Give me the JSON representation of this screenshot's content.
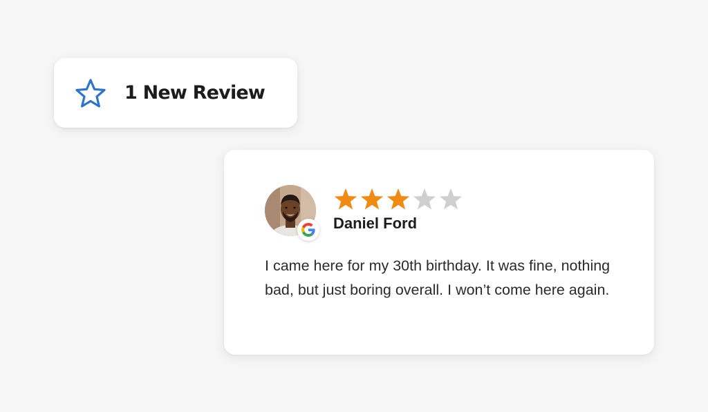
{
  "notification": {
    "icon": "star-outline-icon",
    "title": "1 New Review",
    "accent_color": "#2f74c9"
  },
  "review": {
    "source_icon": "google-g-icon",
    "rating": 3,
    "max_rating": 5,
    "star_filled_color": "#f08a12",
    "star_empty_color": "#cfcfcf",
    "reviewer_name": "Daniel Ford",
    "text": "I came here for my 30th birthday. It was fine, nothing bad, but just boring overall. I won’t come here again."
  }
}
